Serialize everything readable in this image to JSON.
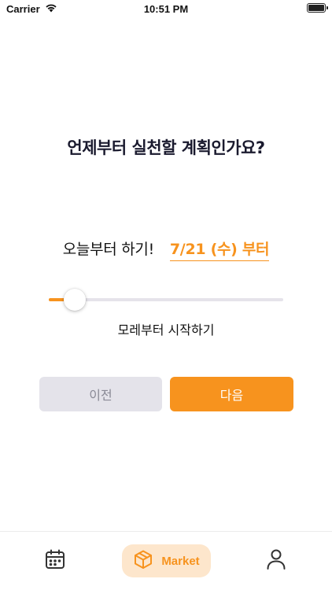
{
  "status_bar": {
    "carrier": "Carrier",
    "time": "10:51 PM",
    "battery_level": 1.0
  },
  "question": "언제부터 실천할 계획인가요?",
  "start": {
    "label": "오늘부터 하기!",
    "date": "7/21 (수) 부터"
  },
  "slider": {
    "caption": "모레부터 시작하기",
    "value": 0.11,
    "accent_color": "#f7931e"
  },
  "buttons": {
    "prev_label": "이전",
    "next_label": "다음"
  },
  "tab_bar": {
    "items": [
      {
        "icon": "calendar-icon",
        "label": ""
      },
      {
        "icon": "box-icon",
        "label": "Market",
        "selected": true
      },
      {
        "icon": "person-icon",
        "label": ""
      }
    ]
  },
  "colors": {
    "accent": "#f7931e",
    "accent_soft": "#fde6cc",
    "button_disabled": "#e4e3ea"
  }
}
